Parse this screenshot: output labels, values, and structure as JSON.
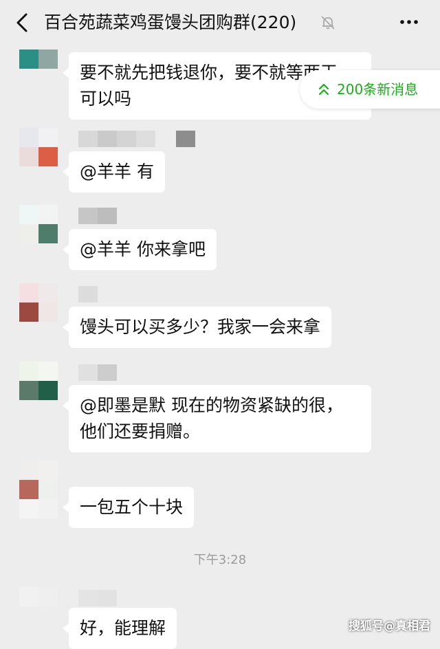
{
  "header": {
    "title": "百合苑蔬菜鸡蛋馒头团购群(220)",
    "back_icon": "chevron-left-icon",
    "mute_icon": "bell-off-icon",
    "more_icon": "more-dots-icon"
  },
  "new_messages": {
    "label": "200条新消息",
    "icon": "double-chevron-up-icon",
    "color": "#1aad19"
  },
  "messages": [
    {
      "lines": [
        "要不就先把钱退你，要不就等两天",
        "可以吗"
      ]
    },
    {
      "lines": [
        "@羊羊  有"
      ]
    },
    {
      "lines": [
        "@羊羊  你来拿吧"
      ]
    },
    {
      "lines": [
        "馒头可以买多少？我家一会来拿"
      ]
    },
    {
      "lines": [
        "@即墨是默  现在的物资紧缺的很，",
        "他们还要捐赠。"
      ]
    },
    {
      "lines": [
        "一包五个十块"
      ]
    },
    {
      "lines": [
        "好，能理解"
      ]
    }
  ],
  "timestamp": "下午3:28",
  "watermark": "搜狐号@真相君",
  "colors": {
    "background": "#ededed",
    "bubble": "#ffffff",
    "accent": "#1aad19"
  }
}
